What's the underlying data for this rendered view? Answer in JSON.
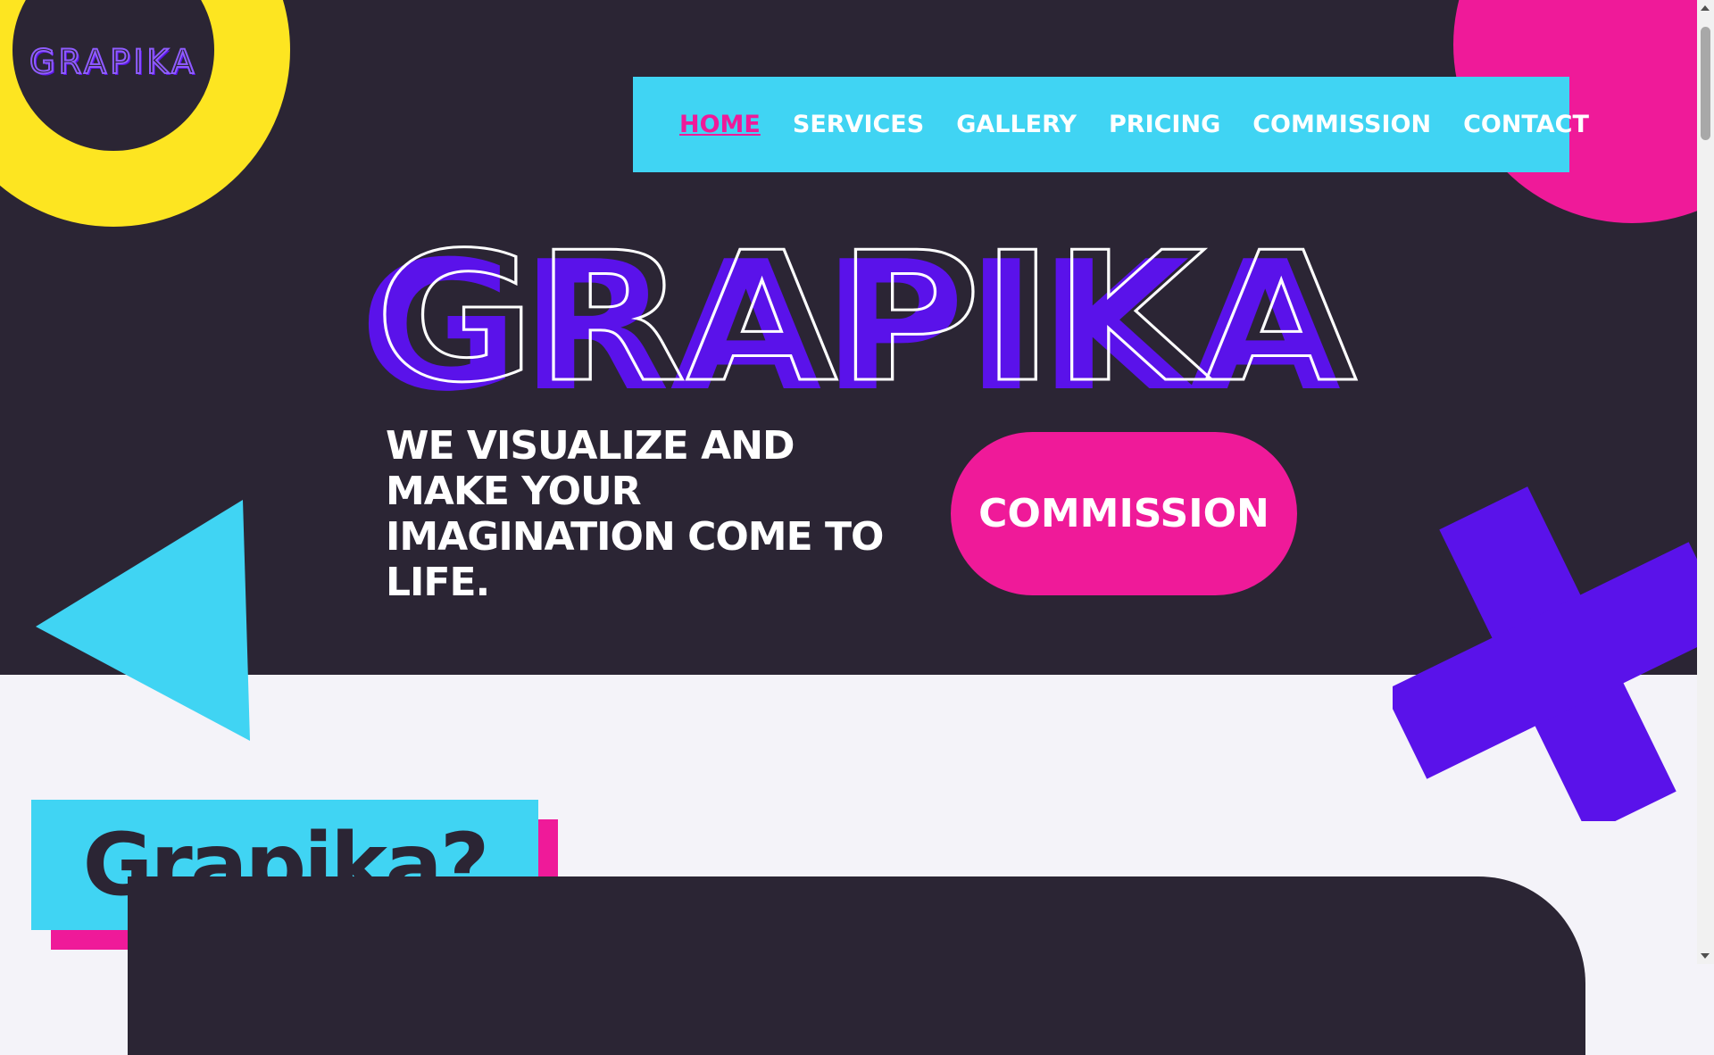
{
  "brand": {
    "logo_text": "GRAPIKA",
    "hero_title": "GRAPIKA"
  },
  "nav": [
    {
      "label": "HOME",
      "active": true
    },
    {
      "label": "SERVICES",
      "active": false
    },
    {
      "label": "GALLERY",
      "active": false
    },
    {
      "label": "PRICING",
      "active": false
    },
    {
      "label": "COMMISSION",
      "active": false
    },
    {
      "label": "CONTACT",
      "active": false
    }
  ],
  "hero": {
    "tagline": "WE VISUALIZE AND MAKE YOUR IMAGINATION COME TO LIFE.",
    "cta_label": "COMMISSION"
  },
  "about": {
    "heading": "Grapika?"
  },
  "colors": {
    "dark": "#2b2534",
    "cyan": "#40d4f3",
    "pink": "#ef1a99",
    "yellow": "#fde521",
    "purple": "#5a12ea",
    "light_bg": "#f4f3f9"
  },
  "icons": [
    "triangle-shape",
    "cross-shape",
    "ring-shape",
    "circle-shape"
  ]
}
